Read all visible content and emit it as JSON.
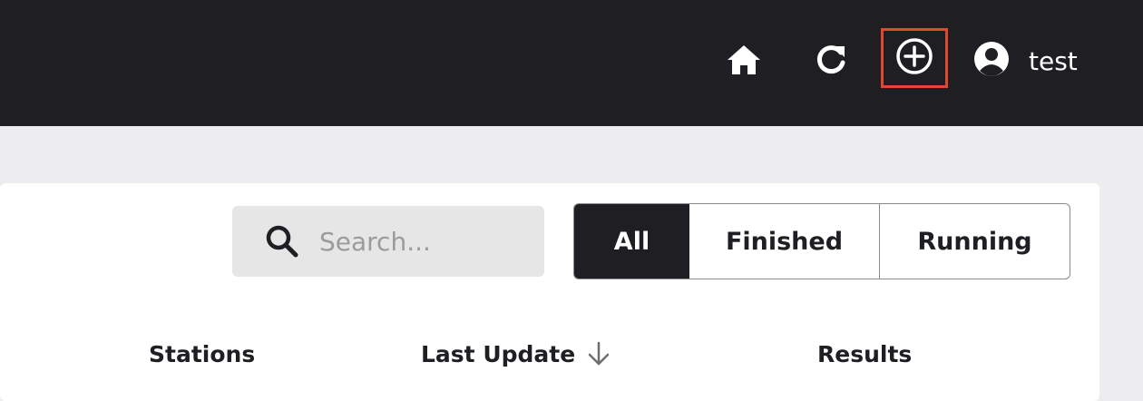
{
  "topbar": {
    "background": "#1f1e23",
    "icons": {
      "home": "home-icon",
      "refresh": "refresh-icon",
      "add": "plus-circle-icon",
      "user": "user-circle-icon"
    },
    "user_name": "test",
    "highlight_color": "#e2472f"
  },
  "search": {
    "placeholder": "Search...",
    "value": "",
    "icon": "search-icon"
  },
  "filters": {
    "options": [
      "All",
      "Finished",
      "Running"
    ],
    "selected": "All"
  },
  "table": {
    "headers": {
      "stations": "Stations",
      "last_update": "Last Update",
      "results": "Results"
    },
    "sort_icon": "arrow-down-icon"
  }
}
